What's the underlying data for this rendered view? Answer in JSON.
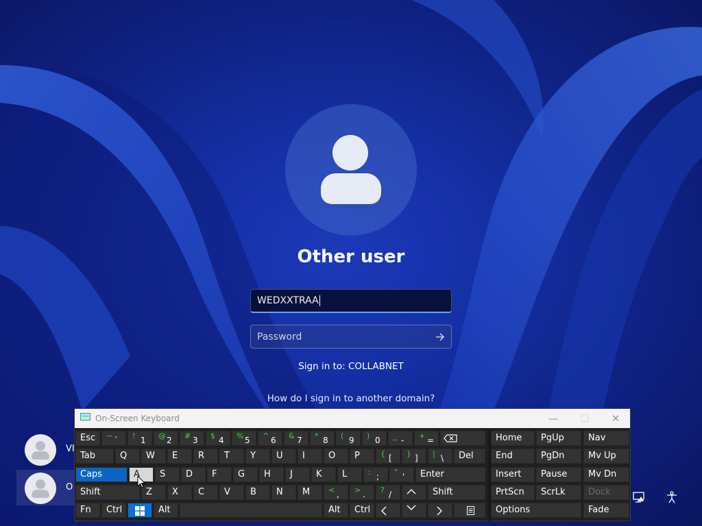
{
  "login": {
    "title": "Other user",
    "username_value": "WEDXXTRAA",
    "password_placeholder": "Password",
    "signin_to": "Sign in to: COLLABNET",
    "domain_link": "How do I sign in to another domain?"
  },
  "user_list": [
    {
      "name_visible": "VI"
    },
    {
      "name_visible": "O"
    }
  ],
  "osk": {
    "title": "On-Screen Keyboard",
    "window_buttons": {
      "minimize": "—",
      "maximize": "☐",
      "close": "✕"
    },
    "row1": {
      "esc": "Esc",
      "tilde_up": "~",
      "tilde_dn": "`",
      "k1_up": "!",
      "k1": "1",
      "k2_up": "@",
      "k2": "2",
      "k3_up": "#",
      "k3": "3",
      "k4_up": "$",
      "k4": "4",
      "k5_up": "%",
      "k5": "5",
      "k6_up": "^",
      "k6": "6",
      "k7_up": "&",
      "k7": "7",
      "k8_up": "*",
      "k8": "8",
      "k9_up": "(",
      "k9": "9",
      "k0_up": ")",
      "k0": "0",
      "minus_up": "_",
      "minus": "-",
      "eq_up": "+",
      "eq": "="
    },
    "row2": {
      "tab": "Tab",
      "q": "Q",
      "w": "W",
      "e": "E",
      "r": "R",
      "t": "T",
      "y": "Y",
      "u": "U",
      "i": "I",
      "o": "O",
      "p": "P",
      "lb_up": "{",
      "lb": "[",
      "rb_up": "}",
      "rb": "]",
      "bs_up": "|",
      "bs": "\\",
      "del": "Del"
    },
    "row3": {
      "caps": "Caps",
      "a": "A",
      "s": "S",
      "d": "D",
      "f": "F",
      "g": "G",
      "h": "H",
      "j": "J",
      "k": "K",
      "l": "L",
      "semi_up": ":",
      "semi": ";",
      "quote_up": "\"",
      "quote": "'",
      "enter": "Enter"
    },
    "row4": {
      "shift_l": "Shift",
      "z": "Z",
      "x": "X",
      "c": "C",
      "v": "V",
      "b": "B",
      "n": "N",
      "m": "M",
      "comma_up": "<",
      "comma": ",",
      "period_up": ">",
      "period": ".",
      "slash_up": "?",
      "slash": "/",
      "shift_r": "Shift"
    },
    "row5": {
      "fn": "Fn",
      "ctrl_l": "Ctrl",
      "alt_l": "Alt",
      "alt_r": "Alt",
      "ctrl_r": "Ctrl"
    },
    "nav": {
      "home": "Home",
      "pgup": "PgUp",
      "navk": "Nav",
      "end": "End",
      "pgdn": "PgDn",
      "mvup": "Mv Up",
      "insert": "Insert",
      "pause": "Pause",
      "mvdn": "Mv Dn",
      "prtscn": "PrtScn",
      "scrlk": "ScrLk",
      "dock": "Dock",
      "options": "Options",
      "fade": "Fade"
    }
  },
  "colors": {
    "caps_active": "#0a66c2",
    "key_bg": "#333333",
    "shift_symbol": "#3fd13f",
    "focus_border": "#60a8ff"
  }
}
